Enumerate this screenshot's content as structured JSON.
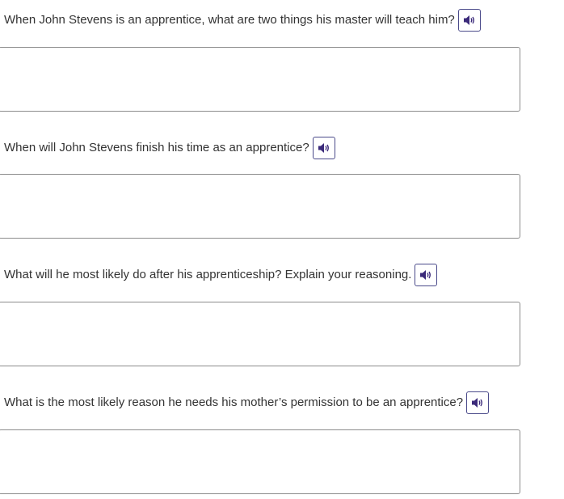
{
  "questions": [
    {
      "text": "When John Stevens is an apprentice, what are two things his master will teach him?",
      "audio_icon": "speaker-icon",
      "answer": ""
    },
    {
      "text": "When will John Stevens finish his time as an apprentice?",
      "audio_icon": "speaker-icon",
      "answer": ""
    },
    {
      "text": "What will he most likely do after his apprenticeship? Explain your reasoning.",
      "audio_icon": "speaker-icon",
      "answer": ""
    },
    {
      "text": "What is the most likely reason he needs his mother’s permission to be an apprentice?",
      "audio_icon": "speaker-icon",
      "answer": ""
    }
  ],
  "colors": {
    "audio_icon": "#3b2a7a",
    "audio_border": "#4a4a8a",
    "box_border": "#8c8c8c",
    "text": "#333333"
  }
}
